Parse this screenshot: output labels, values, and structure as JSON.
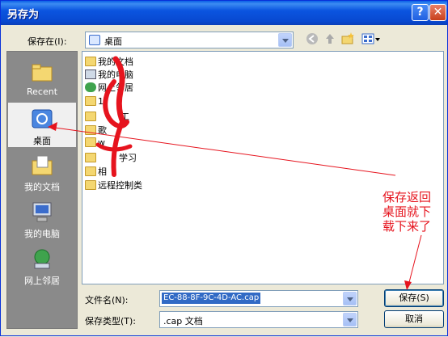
{
  "window": {
    "title": "另存为",
    "help_glyph": "?",
    "close_glyph": "✕"
  },
  "save_in": {
    "label": "保存在(I):",
    "value": "桌面"
  },
  "places": [
    {
      "label": "Recent"
    },
    {
      "label": "桌面"
    },
    {
      "label": "我的文档"
    },
    {
      "label": "我的电脑"
    },
    {
      "label": "网上邻居"
    }
  ],
  "files": [
    {
      "name": "我的文档"
    },
    {
      "name": "我的电脑"
    },
    {
      "name": "网上邻居"
    },
    {
      "name": "1"
    },
    {
      "name": "工"
    },
    {
      "name": "歌"
    },
    {
      "name": "w"
    },
    {
      "name": "学习"
    },
    {
      "name": "相"
    },
    {
      "name": "远程控制类"
    }
  ],
  "filename": {
    "label": "文件名(N):",
    "value": "EC-88-8F-9C-4D-AC.cap"
  },
  "filetype": {
    "label": "保存类型(T):",
    "value": ".cap 文档"
  },
  "buttons": {
    "save": "保存(S)",
    "cancel": "取消"
  },
  "annotation": {
    "lines": [
      "保存返回",
      "桌面就下",
      "载下来了"
    ]
  },
  "colors": {
    "annotation": "#e6141e",
    "title_bar": "#0a5fe6"
  }
}
